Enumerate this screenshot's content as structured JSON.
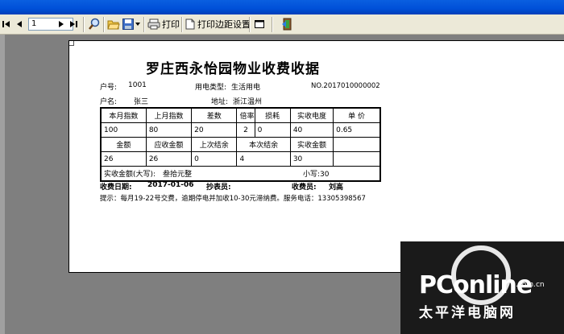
{
  "toolbar": {
    "page_number": "1",
    "print_label": "打印",
    "print_margin_label": "打印边距设置",
    "icons": [
      "first-page-icon",
      "prev-page-icon",
      "next-page-icon",
      "last-page-icon",
      "zoom-icon",
      "open-folder-icon",
      "save-icon",
      "dropdown-arrow-icon",
      "printer-icon",
      "page-setup-icon",
      "window-icon",
      "exit-icon"
    ]
  },
  "receipt": {
    "title": "罗庄西永怡园物业收费收据",
    "account_label": "户号:",
    "account_value": "1001",
    "type_label": "用电类型:",
    "type_value": "生活用电",
    "receipt_no": "NO.2017010000002",
    "name_label": "户名:",
    "name_value": "张三",
    "address_label": "地址:",
    "address_value": "浙江温州",
    "table_header1": [
      "本月指数",
      "上月指数",
      "差数",
      "倍率",
      "损耗",
      "实收电度",
      "单  价"
    ],
    "table_row1": [
      "100",
      "80",
      "20",
      "2",
      "0",
      "40",
      "0.65"
    ],
    "table_header2": [
      "金额",
      "应收金额",
      "上次结余",
      "本次结余",
      "实收金额",
      ""
    ],
    "table_row2": [
      "26",
      "26",
      "0",
      "4",
      "30",
      ""
    ],
    "amount_upper_label": "实收金额(大写):",
    "amount_upper_value": "叁拾元整",
    "amount_lower": "小写:30",
    "date_label": "收费日期:",
    "date_value": "2017-01-06",
    "reader_label": "抄表员:",
    "collector_label": "收费员:",
    "collector_value": "刘高",
    "notice": "提示：每月19-22号交费，逾期停电并加收10-30元滞纳费。服务电话：13305398567"
  },
  "watermark": {
    "brand": "PConline",
    "domain": ".com.cn",
    "chinese": "太平洋电脑网"
  }
}
